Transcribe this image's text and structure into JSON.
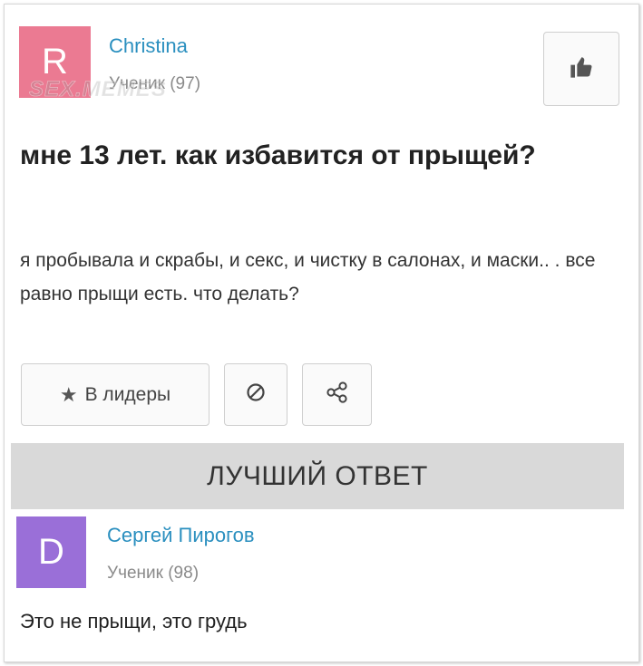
{
  "question": {
    "author": {
      "initial": "R",
      "name": "Christina",
      "rank": "Ученик (97)",
      "avatar_color": "#eb7a92"
    },
    "watermark": "SEX.MEMES",
    "title": "мне 13 лет. как избавится от прыщей?",
    "text": "я пробывала и скрабы, и секс, и чистку в салонах, и маски.. . все равно прыщи есть. что делать?",
    "like_icon": "thumbs-up-icon"
  },
  "actions": {
    "leaders_label": "В лидеры",
    "star_icon": "star-icon",
    "block_icon": "block-icon",
    "share_icon": "share-icon"
  },
  "best_answer": {
    "header": "ЛУЧШИЙ ОТВЕТ",
    "author": {
      "initial": "D",
      "name": "Сергей Пирогов",
      "rank": "Ученик (98)",
      "avatar_color": "#9a6fd8"
    },
    "text": "Это не прыщи, это грудь"
  },
  "colors": {
    "link": "#2a8fbf",
    "bar": "#d9d9d9"
  }
}
